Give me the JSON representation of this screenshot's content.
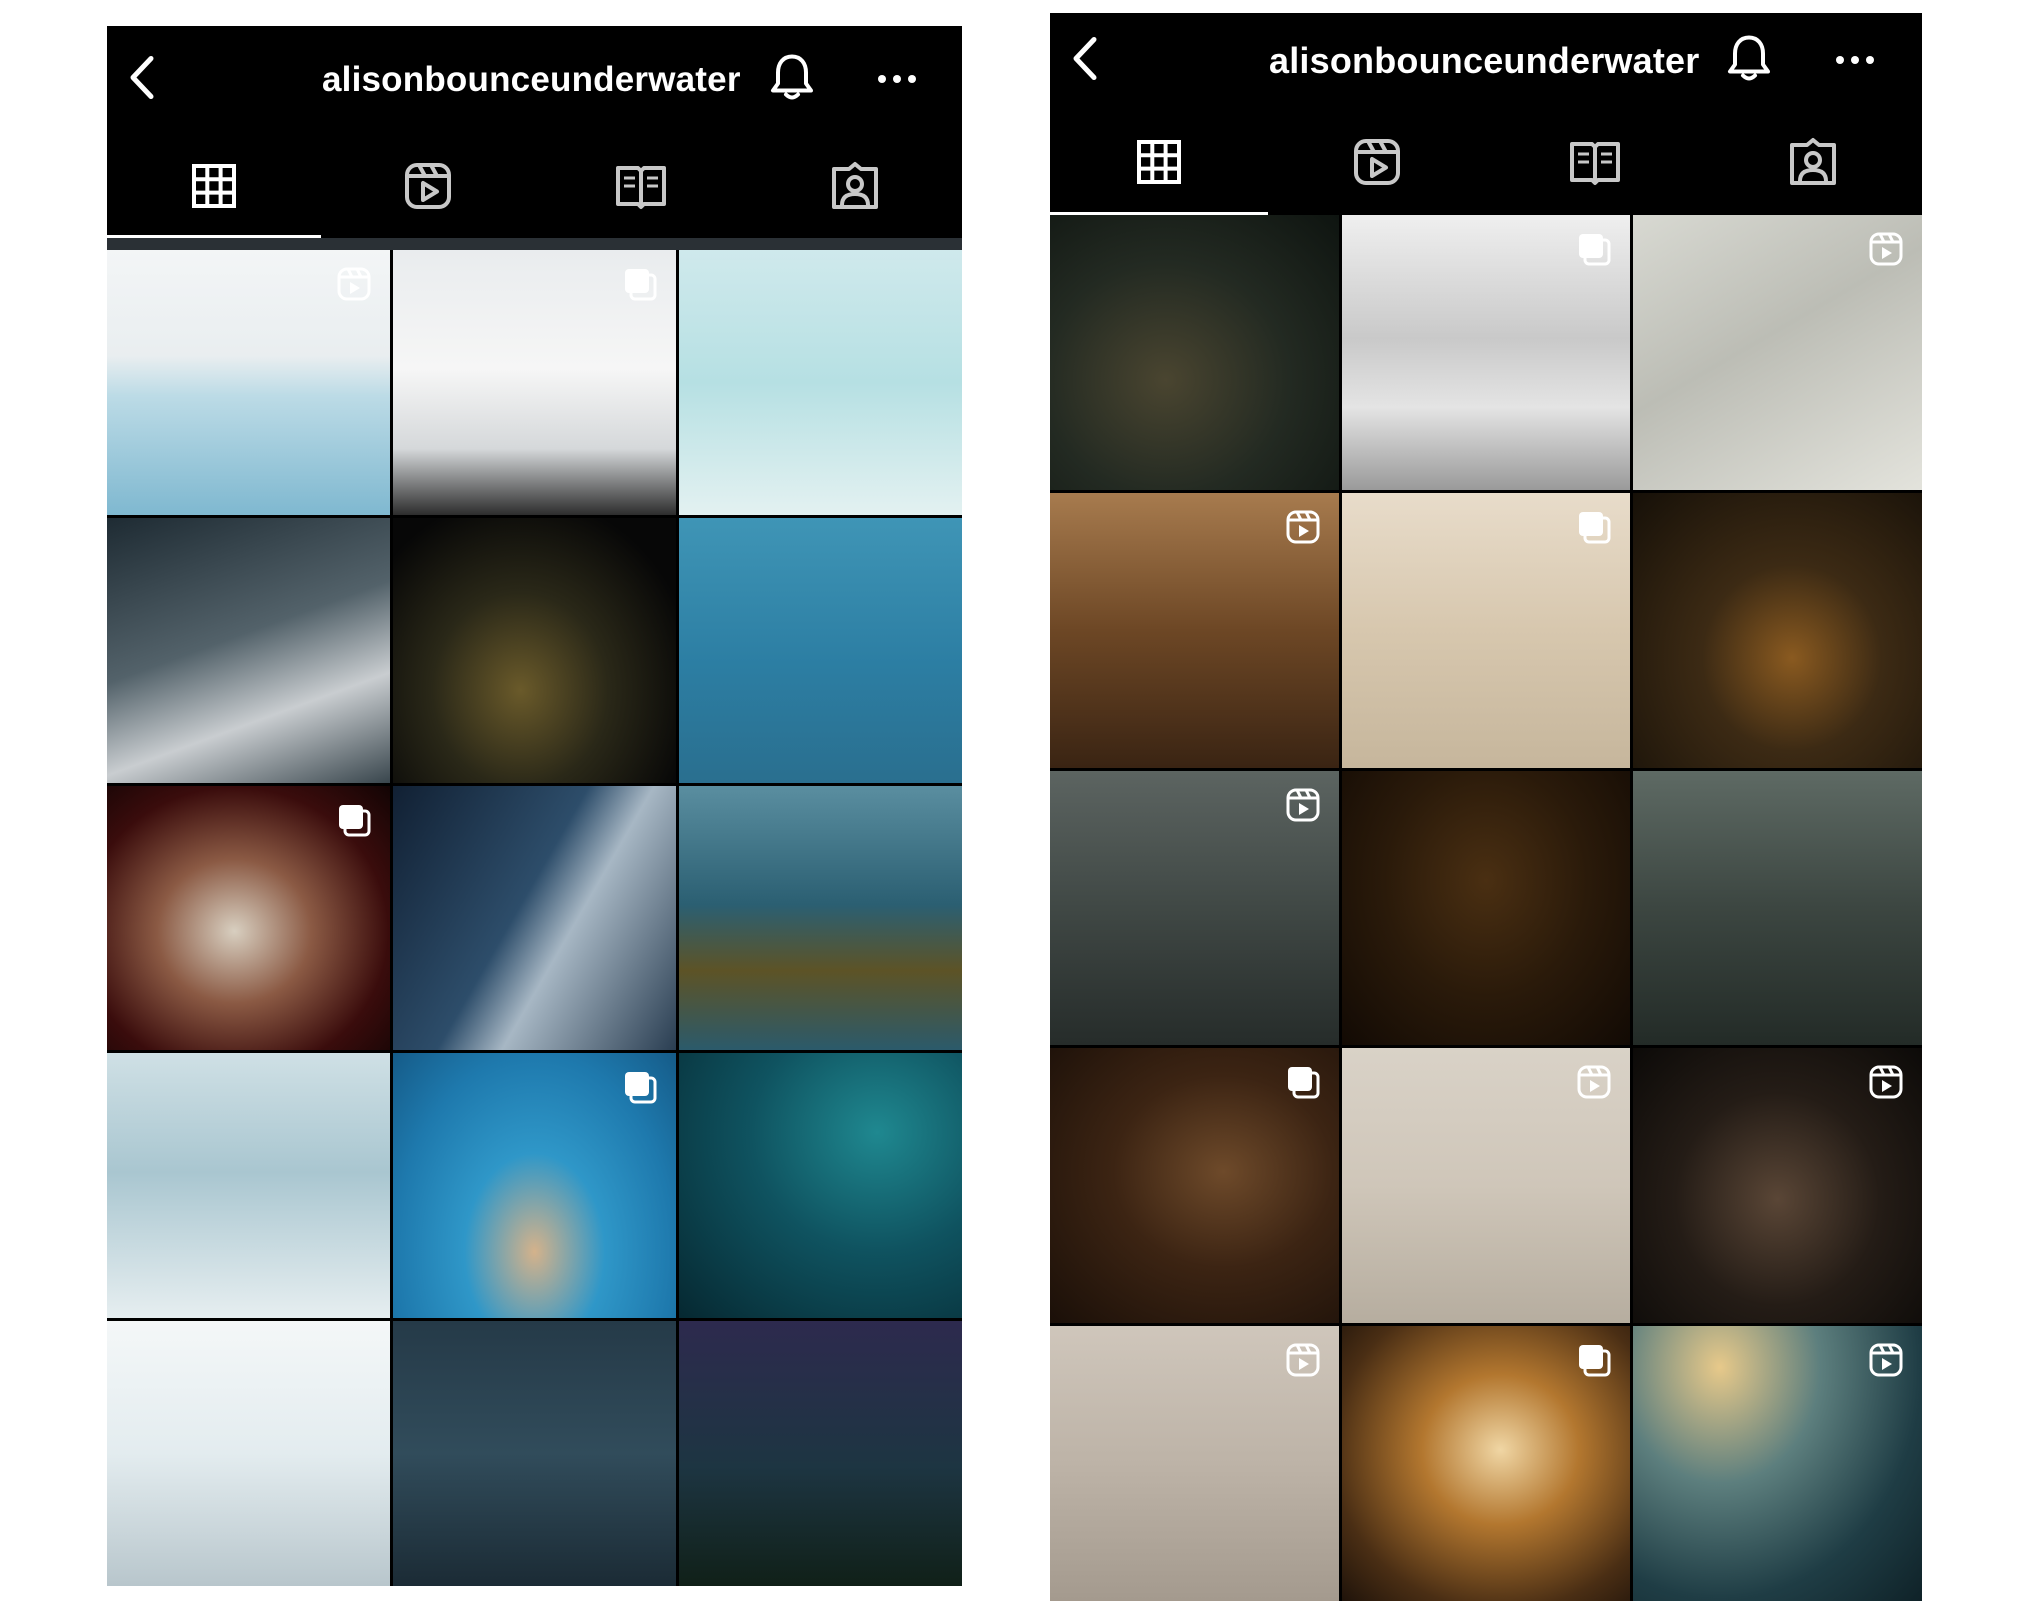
{
  "left_profile": {
    "username": "alisonbounceunderwater",
    "tabs": [
      {
        "name": "posts",
        "icon": "grid-icon",
        "active": true
      },
      {
        "name": "reels",
        "icon": "reels-icon",
        "active": false
      },
      {
        "name": "guides",
        "icon": "guide-icon",
        "active": false
      },
      {
        "name": "tagged",
        "icon": "tagged-icon",
        "active": false
      }
    ],
    "posts": [
      {
        "bg": "linear-gradient(180deg,#f3f5f6 0%,#e9eef0 40%,#bcdbe6 55%,#7fb8d0 100%)",
        "badge": "reel"
      },
      {
        "bg": "linear-gradient(180deg,#e9ecee 0%,#f6f6f6 45%,#d5d8da 75%,#2d2d2d 100%)",
        "badge": "carousel"
      },
      {
        "bg": "linear-gradient(180deg,#cfe9ec 0%,#b6e0e3 50%,#e3f1f1 100%)",
        "badge": ""
      },
      {
        "bg": "linear-gradient(160deg,#1e2b33 0%,#53626a 45%,#c9cdd0 70%,#39464d 100%)",
        "badge": ""
      },
      {
        "bg": "radial-gradient(ellipse at 45% 65%,#6a5a2a 0%,#2a2818 40%,#070707 80%)",
        "badge": ""
      },
      {
        "bg": "linear-gradient(180deg,#3f95b6 0%,#2c7ea3 55%,#2a6f8f 100%)",
        "badge": ""
      },
      {
        "bg": "radial-gradient(ellipse at 45% 55%,#d8cfc0 0%,#8b5a44 35%,#3a0c0c 70%,#120404 100%)",
        "badge": "carousel"
      },
      {
        "bg": "linear-gradient(120deg,#112033 0%,#2d4d6a 45%,#a7b7c4 60%,#2a3e52 100%)",
        "badge": ""
      },
      {
        "bg": "linear-gradient(180deg,#5a8ea0 0%,#2b5f72 45%,#5d5326 70%,#2b5a6b 100%)",
        "badge": ""
      },
      {
        "bg": "linear-gradient(180deg,#cfe0e5 0%,#a9c6d0 45%,#e6eef0 100%)",
        "badge": ""
      },
      {
        "bg": "radial-gradient(ellipse at 50% 75%,#d4b28b 0%,#2f97c8 35%,#1e79ad 70%,#155b88 100%)",
        "badge": "carousel"
      },
      {
        "bg": "radial-gradient(ellipse at 70% 30%,#1f8890 0%,#0f5360 45%,#062831 100%)",
        "badge": ""
      },
      {
        "bg": "linear-gradient(180deg,#f4f7f8 0%,#e3ecef 50%,#b8c6cc 100%)",
        "badge": ""
      },
      {
        "bg": "linear-gradient(180deg,#253a48 0%,#314c5b 50%,#1b2b35 100%)",
        "badge": ""
      },
      {
        "bg": "linear-gradient(180deg,#2d2a4e 0%,#1d3542 55%,#102018 100%)",
        "badge": ""
      }
    ]
  },
  "right_profile": {
    "username": "alisonbounceunderwater",
    "tabs": [
      {
        "name": "posts",
        "icon": "grid-icon",
        "active": true
      },
      {
        "name": "reels",
        "icon": "reels-icon",
        "active": false
      },
      {
        "name": "guides",
        "icon": "guide-icon",
        "active": false
      },
      {
        "name": "tagged",
        "icon": "tagged-icon",
        "active": false
      }
    ],
    "posts": [
      {
        "bg": "radial-gradient(ellipse at 40% 60%,#4a4530 0%,#232a22 50%,#0e1410 100%)",
        "badge": ""
      },
      {
        "bg": "linear-gradient(180deg,#efefef 0%,#c9c9c9 45%,#e4e4e4 70%,#9a9a9a 100%)",
        "badge": "carousel"
      },
      {
        "bg": "linear-gradient(150deg,#d8d9d2 0%,#bcbdb5 45%,#e3e3dc 100%)",
        "badge": "reel"
      },
      {
        "bg": "linear-gradient(180deg,#a77b4e 0%,#6d4725 50%,#3a2413 100%)",
        "badge": "reel"
      },
      {
        "bg": "linear-gradient(180deg,#e8dcca 0%,#d7c7ae 50%,#c6b69c 100%)",
        "badge": "carousel"
      },
      {
        "bg": "radial-gradient(ellipse at 55% 60%,#8a5a20 0%,#3c2a14 40%,#161008 100%)",
        "badge": ""
      },
      {
        "bg": "linear-gradient(180deg,#5c6461 0%,#404845 50%,#262c2a 100%)",
        "badge": "reel"
      },
      {
        "bg": "radial-gradient(ellipse at 50% 40%,#4a2f12 0%,#2a1a0a 50%,#120a04 100%)",
        "badge": ""
      },
      {
        "bg": "linear-gradient(180deg,#5e6a64 0%,#3c4641 50%,#232b27 100%)",
        "badge": ""
      },
      {
        "bg": "radial-gradient(ellipse at 60% 45%,#6e4a2a 0%,#3c2413 45%,#1a0f08 100%)",
        "badge": "carousel"
      },
      {
        "bg": "linear-gradient(180deg,#d9d2c7 0%,#cfc6b9 50%,#b6ad9f 100%)",
        "badge": "reel"
      },
      {
        "bg": "radial-gradient(ellipse at 50% 55%,#5a4636 0%,#241c16 50%,#0c0a08 100%)",
        "badge": "reel"
      },
      {
        "bg": "linear-gradient(180deg,#cfc6bb 0%,#bdb3a7 50%,#a49a8e 100%)",
        "badge": "reel"
      },
      {
        "bg": "radial-gradient(ellipse at 55% 45%,#f0d6a4 0%,#b3772f 35%,#4a2e14 75%,#1f130a 100%)",
        "badge": "carousel"
      },
      {
        "bg": "radial-gradient(ellipse at 30% 15%,#e7c98a 0%,#5d7f7e 35%,#1f3d45 70%,#0f2228 100%)",
        "badge": "reel"
      }
    ]
  },
  "colors": {
    "header_bg": "#000000",
    "header_text": "#ffffff",
    "tab_indicator": "#ffffff"
  }
}
